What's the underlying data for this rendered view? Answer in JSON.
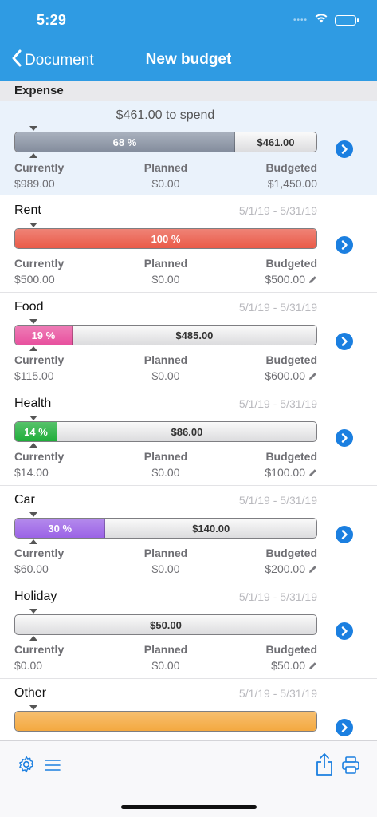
{
  "status": {
    "time": "5:29",
    "signal": "••••"
  },
  "nav": {
    "back_label": "Document",
    "title": "New budget"
  },
  "section": {
    "title": "Expense"
  },
  "summary": {
    "to_spend": "$461.00 to spend",
    "percent_label": "68 %",
    "percent": 0.73,
    "remaining_label": "$461.00",
    "currently_label": "Currently",
    "currently_value": "$989.00",
    "planned_label": "Planned",
    "planned_value": "$0.00",
    "budgeted_label": "Budgeted",
    "budgeted_value": "$1,450.00"
  },
  "rows": [
    {
      "name": "Rent",
      "dates": "5/1/19 - 5/31/19",
      "percent_label": "100 %",
      "percent": 1.0,
      "remaining_label": "",
      "color": "#ea5a48",
      "currently_label": "Currently",
      "currently_value": "$500.00",
      "planned_label": "Planned",
      "planned_value": "$0.00",
      "budgeted_label": "Budgeted",
      "budgeted_value": "$500.00"
    },
    {
      "name": "Food",
      "dates": "5/1/19 - 5/31/19",
      "percent_label": "19 %",
      "percent": 0.19,
      "remaining_label": "$485.00",
      "color": "#e8519f",
      "currently_label": "Currently",
      "currently_value": "$115.00",
      "planned_label": "Planned",
      "planned_value": "$0.00",
      "budgeted_label": "Budgeted",
      "budgeted_value": "$600.00"
    },
    {
      "name": "Health",
      "dates": "5/1/19 - 5/31/19",
      "percent_label": "14 %",
      "percent": 0.14,
      "remaining_label": "$86.00",
      "color": "#1fae3a",
      "currently_label": "Currently",
      "currently_value": "$14.00",
      "planned_label": "Planned",
      "planned_value": "$0.00",
      "budgeted_label": "Budgeted",
      "budgeted_value": "$100.00"
    },
    {
      "name": "Car",
      "dates": "5/1/19 - 5/31/19",
      "percent_label": "30 %",
      "percent": 0.3,
      "remaining_label": "$140.00",
      "color": "#9b63e6",
      "currently_label": "Currently",
      "currently_value": "$60.00",
      "planned_label": "Planned",
      "planned_value": "$0.00",
      "budgeted_label": "Budgeted",
      "budgeted_value": "$200.00"
    },
    {
      "name": "Holiday",
      "dates": "5/1/19 - 5/31/19",
      "percent_label": "",
      "percent": 0.0,
      "remaining_label": "$50.00",
      "color": "#cccccc",
      "currently_label": "Currently",
      "currently_value": "$0.00",
      "planned_label": "Planned",
      "planned_value": "$0.00",
      "budgeted_label": "Budgeted",
      "budgeted_value": "$50.00"
    },
    {
      "name": "Other",
      "dates": "5/1/19 - 5/31/19",
      "percent_label": "",
      "percent": 1.0,
      "remaining_label": "",
      "color": "#f4a940",
      "currently_label": "",
      "currently_value": "",
      "planned_label": "",
      "planned_value": "",
      "budgeted_label": "",
      "budgeted_value": ""
    }
  ],
  "colors": {
    "accent": "#2f9be3",
    "chevron": "#1b7fe0",
    "summary_fill": "#8f98a8"
  },
  "toolbar": {
    "icons": [
      "gear-icon",
      "list-icon",
      "share-icon",
      "print-icon"
    ]
  }
}
